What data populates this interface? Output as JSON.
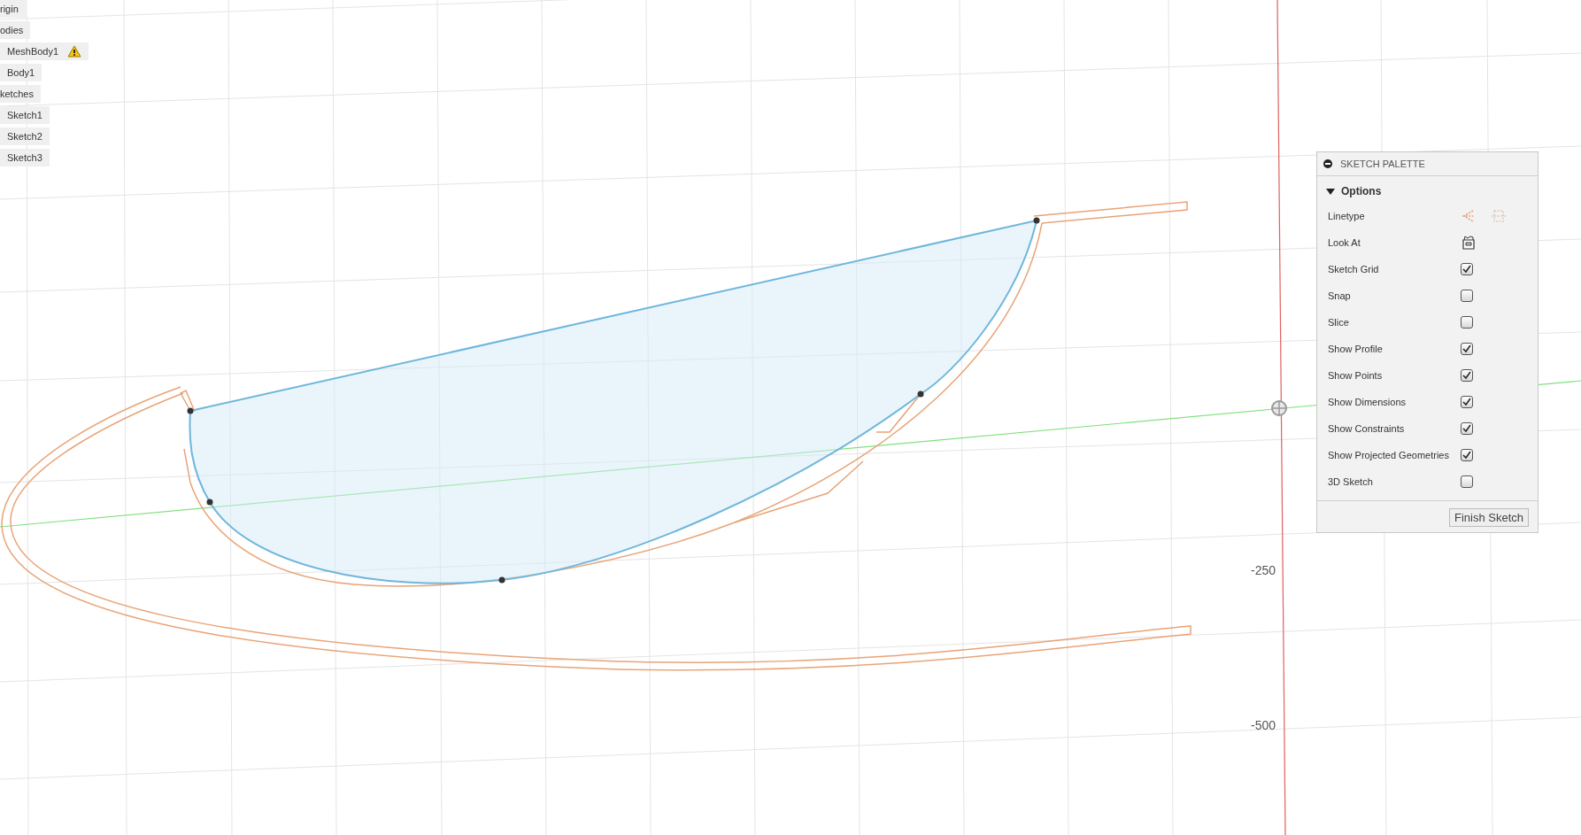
{
  "browser": {
    "items": [
      {
        "label": "rigin",
        "warning": false
      },
      {
        "label": "odies",
        "warning": false,
        "children": [
          {
            "label": "MeshBody1",
            "warning": true
          },
          {
            "label": "Body1",
            "warning": false
          }
        ]
      },
      {
        "label": "ketches",
        "warning": false,
        "children": [
          {
            "label": "Sketch1",
            "warning": false
          },
          {
            "label": "Sketch2",
            "warning": false
          },
          {
            "label": "Sketch3",
            "warning": false
          }
        ]
      }
    ]
  },
  "canvas": {
    "axis_labels": [
      "-250",
      "-500"
    ]
  },
  "sketch_palette": {
    "title": "SKETCH PALETTE",
    "section": {
      "label": "Options",
      "expanded": true
    },
    "rows": [
      {
        "kind": "linetype",
        "label": "Linetype"
      },
      {
        "kind": "lookat",
        "label": "Look At"
      },
      {
        "kind": "checkbox",
        "label": "Sketch Grid",
        "checked": true
      },
      {
        "kind": "checkbox",
        "label": "Snap",
        "checked": false
      },
      {
        "kind": "checkbox",
        "label": "Slice",
        "checked": false
      },
      {
        "kind": "checkbox",
        "label": "Show Profile",
        "checked": true
      },
      {
        "kind": "checkbox",
        "label": "Show Points",
        "checked": true
      },
      {
        "kind": "checkbox",
        "label": "Show Dimensions",
        "checked": true
      },
      {
        "kind": "checkbox",
        "label": "Show Constraints",
        "checked": true
      },
      {
        "kind": "checkbox",
        "label": "Show Projected Geometries",
        "checked": true
      },
      {
        "kind": "checkbox",
        "label": "3D Sketch",
        "checked": false
      }
    ],
    "button": "Finish Sketch"
  }
}
